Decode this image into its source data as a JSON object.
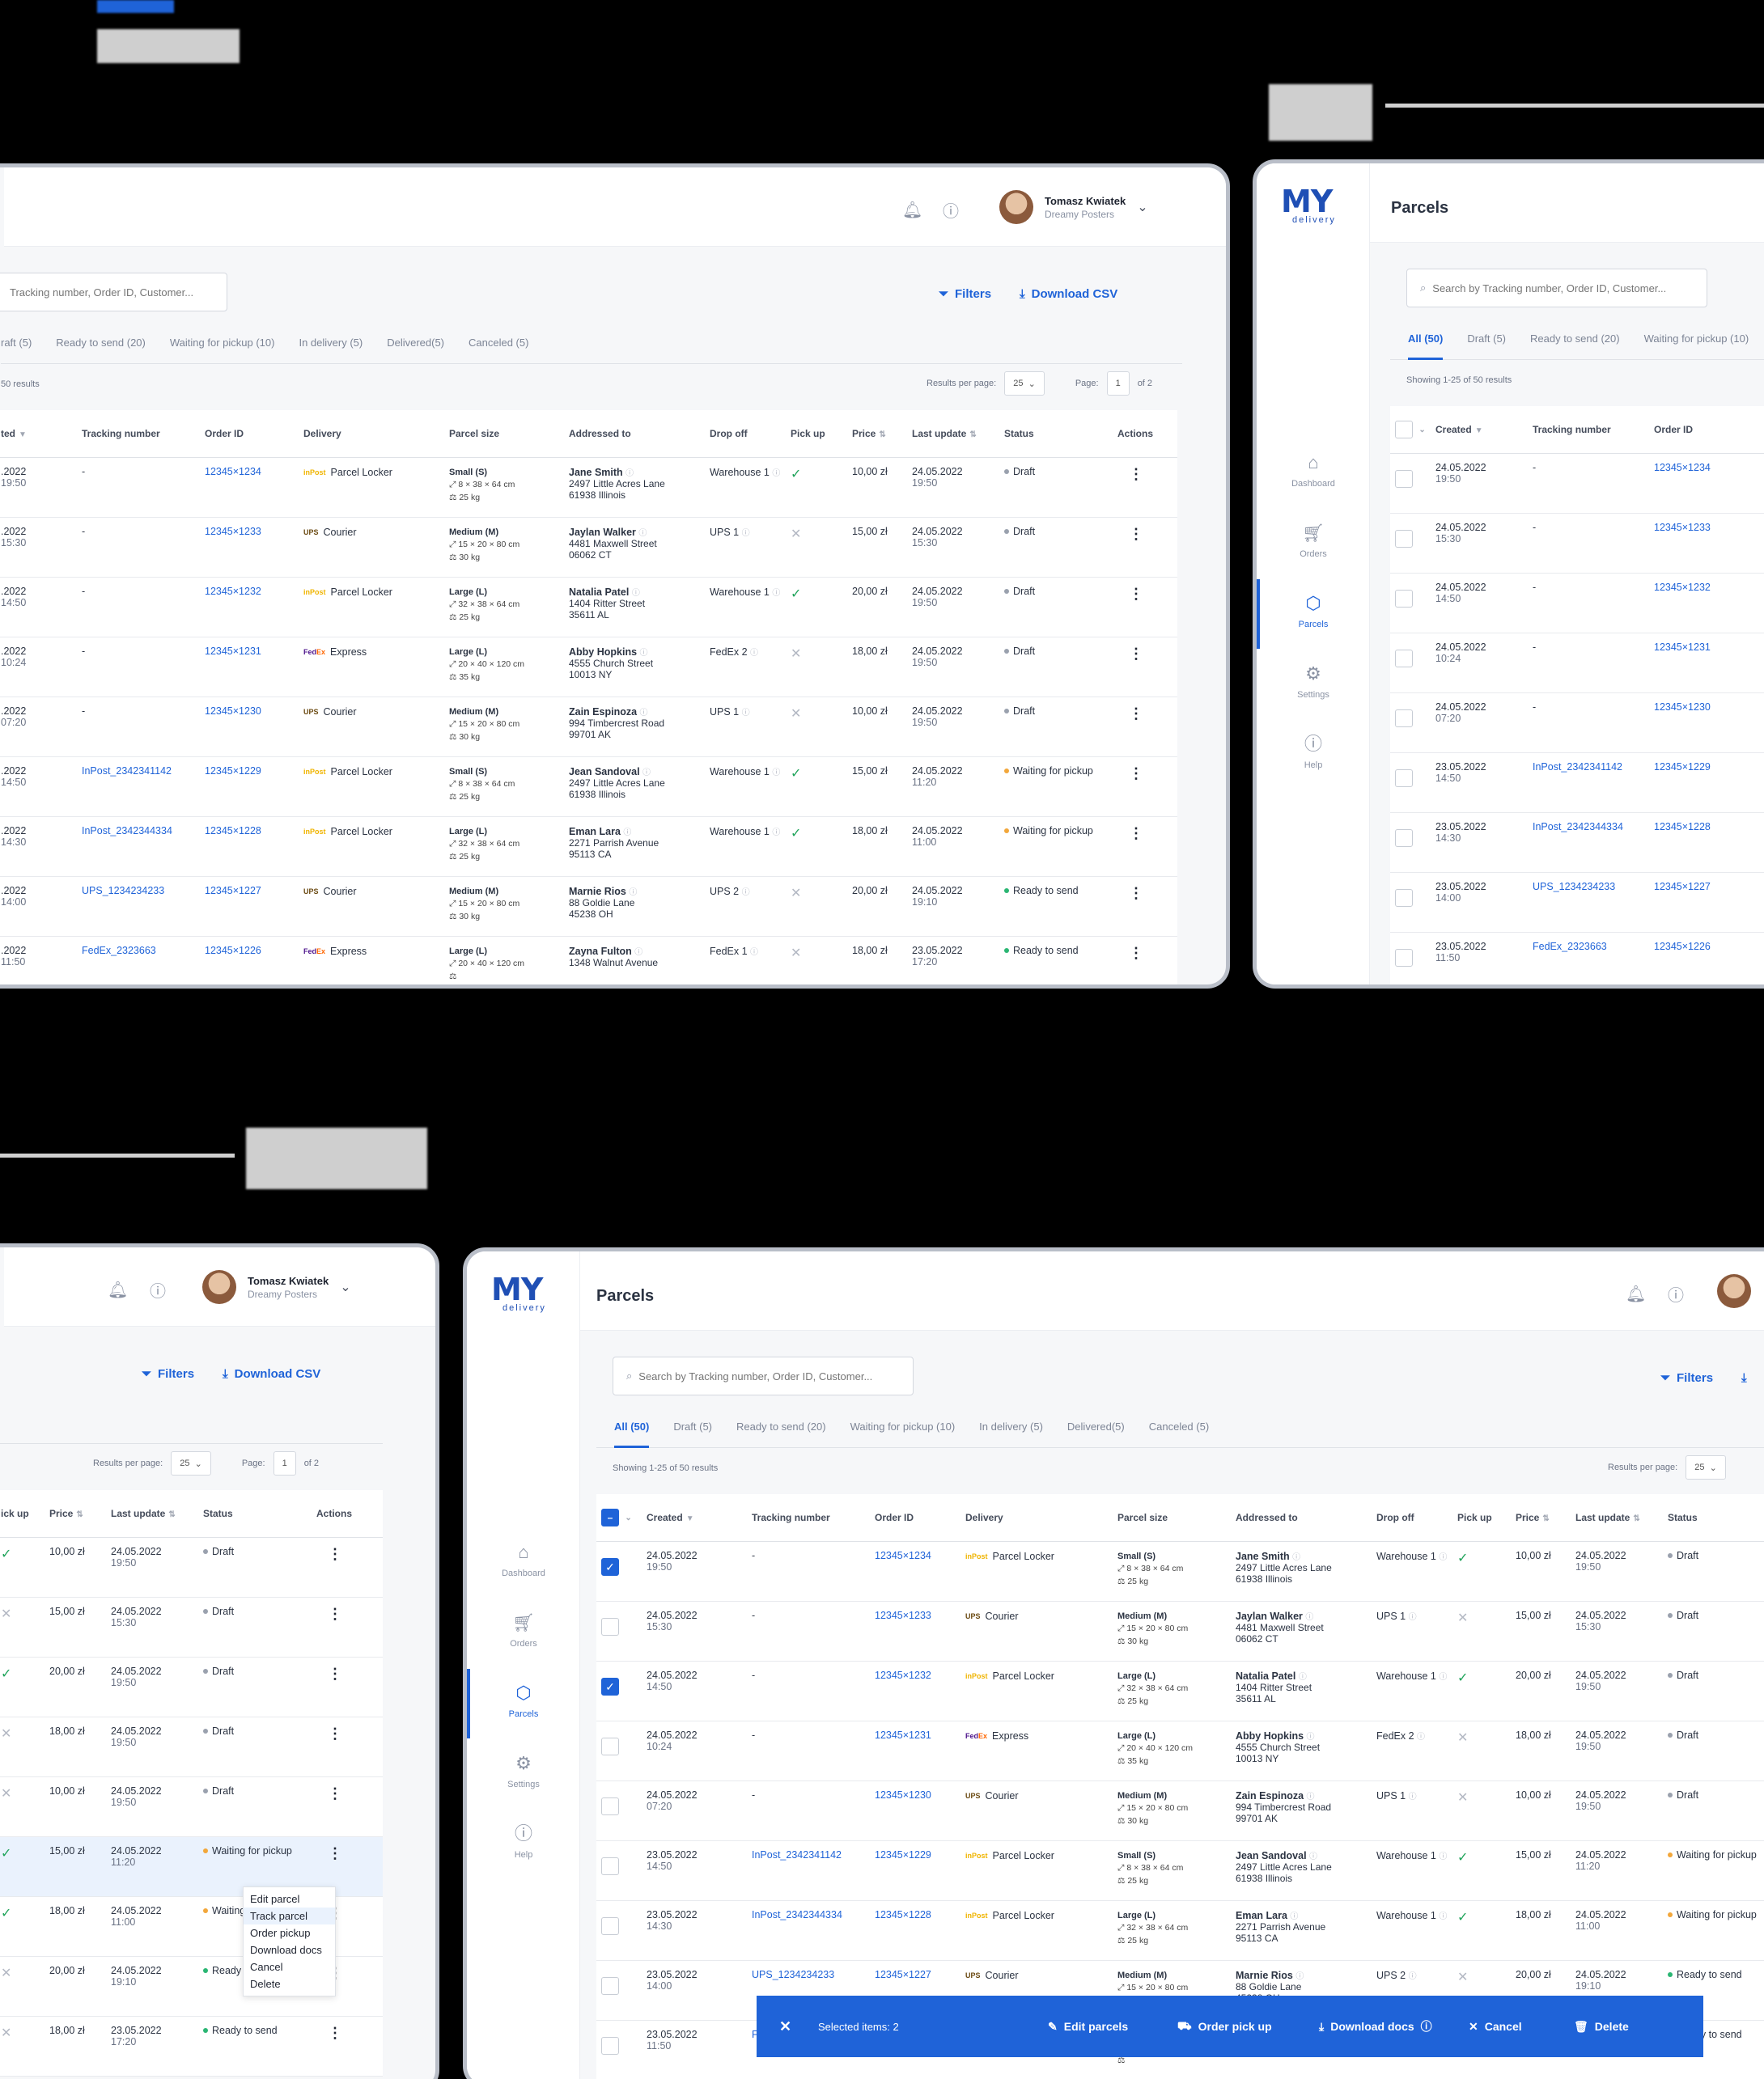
{
  "header": {
    "title": "Parcels",
    "user_name": "Tomasz Kwiatek",
    "company": "Dreamy Posters"
  },
  "logo": {
    "line1": "MY",
    "line2": "delivery"
  },
  "nav": [
    "Dashboard",
    "Orders",
    "Parcels",
    "Settings",
    "Help"
  ],
  "search_placeholder_full": "Search by Tracking number, Order ID, Customer...",
  "search_placeholder_short": "Tracking number, Order ID, Customer...",
  "filters_label": "Filters",
  "download_label": "Download CSV",
  "tabs": [
    "All (50)",
    "Draft (5)",
    "Ready to send (20)",
    "Waiting for pickup (10)",
    "In delivery (5)",
    "Delivered(5)",
    "Canceled (5)"
  ],
  "tabs_partial": "raft (5)",
  "results_text": "Showing 1-25 of 50 results",
  "results_partial": "50 results",
  "per_page_label": "Results per page:",
  "per_page_value": "25",
  "page_label": "Page:",
  "page_value": "1",
  "page_of": "of 2",
  "columns": {
    "created": "Created",
    "created_partial": "ted",
    "tracking": "Tracking number",
    "order": "Order ID",
    "delivery": "Delivery",
    "size": "Parcel size",
    "address": "Addressed to",
    "dropoff": "Drop off",
    "pickup": "Pick up",
    "pickup_partial": "ick up",
    "price": "Price",
    "update": "Last update",
    "status": "Status",
    "actions": "Actions"
  },
  "rows": [
    {
      "date": "24.05.2022",
      "date_cut": ".2022",
      "time": "19:50",
      "tracking": "-",
      "order": "12345×1234",
      "carrier": "Parcel Locker",
      "size": "Small (S)",
      "dims": "8 × 38 × 64 cm",
      "weight": "25 kg",
      "name": "Jane Smith",
      "street": "2497 Little Acres Lane",
      "city": "61938 Illinois",
      "dropoff": "Warehouse 1",
      "pickup": true,
      "price": "10,00 zł",
      "upd_date": "24.05.2022",
      "upd_time": "19:50",
      "status": "Draft"
    },
    {
      "date": "24.05.2022",
      "date_cut": ".2022",
      "time": "15:30",
      "tracking": "-",
      "order": "12345×1233",
      "carrier": "Courier",
      "size": "Medium (M)",
      "dims": "15 × 20 × 80 cm",
      "weight": "30 kg",
      "name": "Jaylan Walker",
      "street": "4481 Maxwell Street",
      "city": "06062 CT",
      "dropoff": "UPS 1",
      "pickup": false,
      "price": "15,00 zł",
      "upd_date": "24.05.2022",
      "upd_time": "15:30",
      "status": "Draft"
    },
    {
      "date": "24.05.2022",
      "date_cut": ".2022",
      "time": "14:50",
      "tracking": "-",
      "order": "12345×1232",
      "carrier": "Parcel Locker",
      "size": "Large (L)",
      "dims": "32 × 38 × 64 cm",
      "weight": "25 kg",
      "name": "Natalia Patel",
      "street": "1404 Ritter Street",
      "city": "35611 AL",
      "dropoff": "Warehouse 1",
      "pickup": true,
      "price": "20,00 zł",
      "upd_date": "24.05.2022",
      "upd_time": "19:50",
      "status": "Draft"
    },
    {
      "date": "24.05.2022",
      "date_cut": ".2022",
      "time": "10:24",
      "tracking": "-",
      "order": "12345×1231",
      "carrier": "Express",
      "size": "Large (L)",
      "dims": "20 × 40 × 120 cm",
      "weight": "35 kg",
      "name": "Abby Hopkins",
      "street": "4555 Church Street",
      "city": "10013 NY",
      "dropoff": "FedEx 2",
      "pickup": false,
      "price": "18,00 zł",
      "upd_date": "24.05.2022",
      "upd_time": "19:50",
      "status": "Draft"
    },
    {
      "date": "24.05.2022",
      "date_cut": ".2022",
      "time": "07:20",
      "tracking": "-",
      "order": "12345×1230",
      "carrier": "Courier",
      "size": "Medium (M)",
      "dims": "15 × 20 × 80 cm",
      "weight": "30 kg",
      "name": "Zain Espinoza",
      "street": "994 Timbercrest Road",
      "city": "99701 AK",
      "dropoff": "UPS 1",
      "pickup": false,
      "price": "10,00 zł",
      "upd_date": "24.05.2022",
      "upd_time": "19:50",
      "status": "Draft"
    },
    {
      "date": "23.05.2022",
      "date_cut": ".2022",
      "time": "14:50",
      "tracking": "InPost_2342341142",
      "order": "12345×1229",
      "carrier": "Parcel Locker",
      "size": "Small (S)",
      "dims": "8 × 38 × 64 cm",
      "weight": "25 kg",
      "name": "Jean Sandoval",
      "street": "2497 Little Acres Lane",
      "city": "61938 Illinois",
      "dropoff": "Warehouse 1",
      "pickup": true,
      "price": "15,00 zł",
      "upd_date": "24.05.2022",
      "upd_time": "11:20",
      "status": "Waiting for pickup"
    },
    {
      "date": "23.05.2022",
      "date_cut": ".2022",
      "time": "14:30",
      "tracking": "InPost_2342344334",
      "order": "12345×1228",
      "carrier": "Parcel Locker",
      "size": "Large (L)",
      "dims": "32 × 38 × 64 cm",
      "weight": "25 kg",
      "name": "Eman Lara",
      "street": "2271 Parrish Avenue",
      "city": "95113 CA",
      "dropoff": "Warehouse 1",
      "pickup": true,
      "price": "18,00 zł",
      "upd_date": "24.05.2022",
      "upd_time": "11:00",
      "status": "Waiting for pickup"
    },
    {
      "date": "23.05.2022",
      "date_cut": ".2022",
      "time": "14:00",
      "tracking": "UPS_1234234233",
      "order": "12345×1227",
      "carrier": "Courier",
      "size": "Medium (M)",
      "dims": "15 × 20 × 80 cm",
      "weight": "30 kg",
      "name": "Marnie Rios",
      "street": "88 Goldie Lane",
      "city": "45238 OH",
      "dropoff": "UPS 2",
      "pickup": false,
      "price": "20,00 zł",
      "upd_date": "24.05.2022",
      "upd_time": "19:10",
      "status": "Ready to send"
    },
    {
      "date": "23.05.2022",
      "date_cut": ".2022",
      "time": "11:50",
      "tracking": "FedEx_2323663",
      "order": "12345×1226",
      "carrier": "Express",
      "size": "Large (L)",
      "dims": "20 × 40 × 120 cm",
      "weight": "",
      "name": "Zayna Fulton",
      "street": "1348 Walnut Avenue",
      "city": "",
      "dropoff": "FedEx 1",
      "pickup": false,
      "price": "18,00 zł",
      "upd_date": "23.05.2022",
      "upd_time": "17:20",
      "status": "Ready to send"
    }
  ],
  "context_menu": [
    "Edit parcel",
    "Track parcel",
    "Order pickup",
    "Download docs",
    "Cancel",
    "Delete"
  ],
  "action_bar": {
    "selected": "Selected items: 2",
    "edit": "Edit parcels",
    "pickup": "Order pick up",
    "docs": "Download docs",
    "cancel": "Cancel",
    "delete": "Delete"
  },
  "status_colors": {
    "Draft": "#9aa1ae",
    "Waiting for pickup": "#f2a73b",
    "Ready to send": "#2bb673"
  },
  "accent": "#1f63d8",
  "icons": [
    "bell-icon",
    "help-icon",
    "search-icon",
    "filter-icon",
    "download-icon",
    "dashboard-icon",
    "cart-icon",
    "parcel-icon",
    "gear-icon",
    "kebab-icon",
    "check-icon",
    "cross-icon"
  ]
}
